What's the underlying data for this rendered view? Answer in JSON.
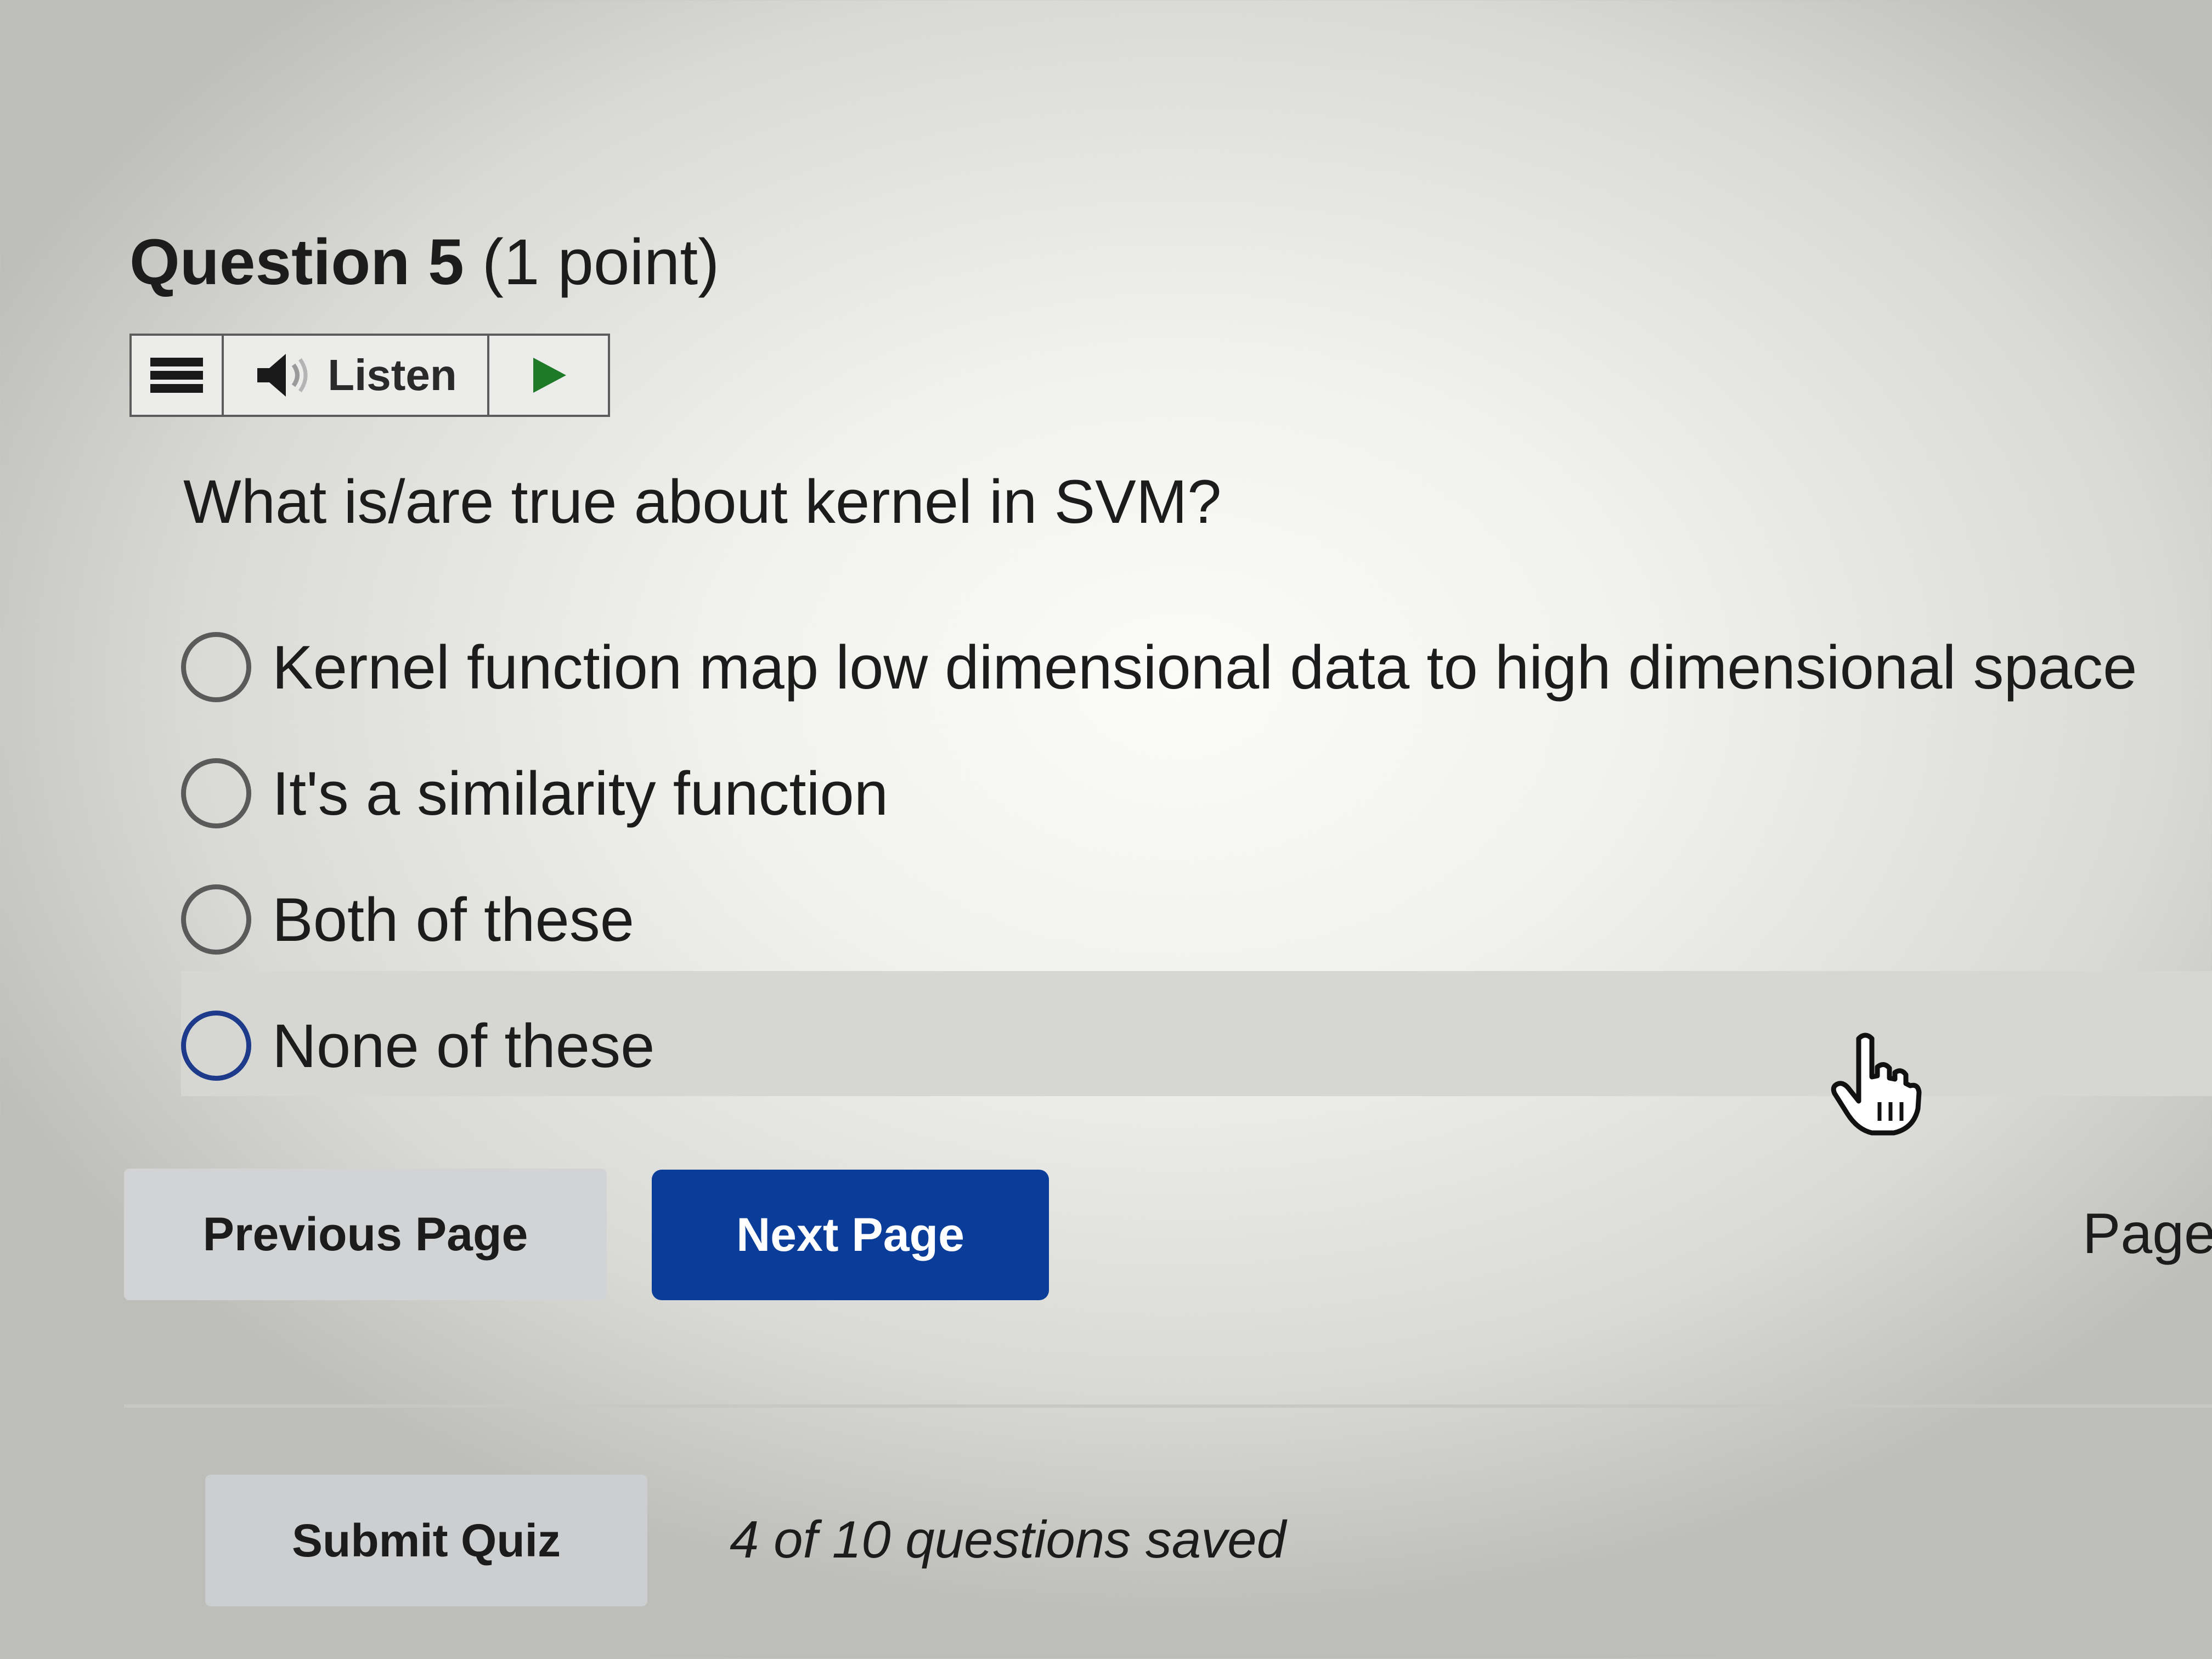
{
  "question": {
    "number_label": "Question 5",
    "points_label": "(1 point)",
    "prompt": "What is/are true about kernel in SVM?"
  },
  "listen_toolbar": {
    "menu_icon": "hamburger-menu-icon",
    "speaker_icon": "speaker-icon",
    "listen_label": "Listen",
    "play_icon": "play-icon"
  },
  "options": [
    {
      "label": "Kernel function map low dimensional data to high dimensional space",
      "selected": false
    },
    {
      "label": "It's a similarity function",
      "selected": false
    },
    {
      "label": "Both of these",
      "selected": false
    },
    {
      "label": "None of these",
      "selected": false,
      "hovered": true
    }
  ],
  "navigation": {
    "previous_label": "Previous Page",
    "next_label": "Next Page",
    "page_label": "Page"
  },
  "footer": {
    "submit_label": "Submit Quiz",
    "save_status": "4 of 10 questions saved"
  },
  "colors": {
    "primary_button": "#0a3d9a",
    "secondary_button": "#d2d3d4",
    "hover_band": "#d6d6d3",
    "focus_radio": "#1e3a8a"
  }
}
